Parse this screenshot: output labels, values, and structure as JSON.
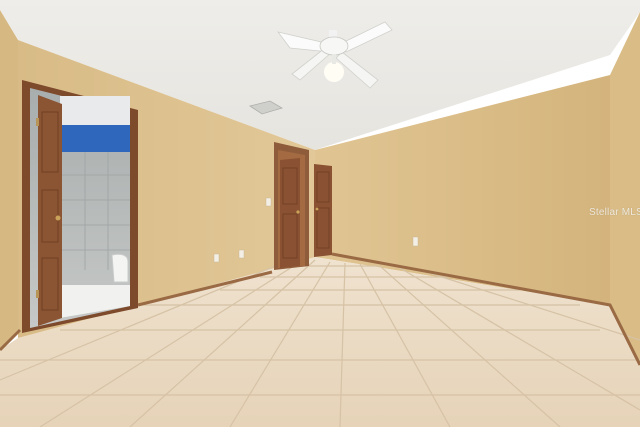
{
  "photo": {
    "watermark_text": "Stellar MLS",
    "colors": {
      "ceiling": "#ecebe7",
      "wall": "#dfc595",
      "wall_shadow": "#d2b47e",
      "floor_tile": "#ead9c2",
      "grout": "#d9c5aa",
      "door_wood": "#8a5232",
      "trim_wood": "#9b6440",
      "bath_accent": "#2f67bd"
    }
  }
}
